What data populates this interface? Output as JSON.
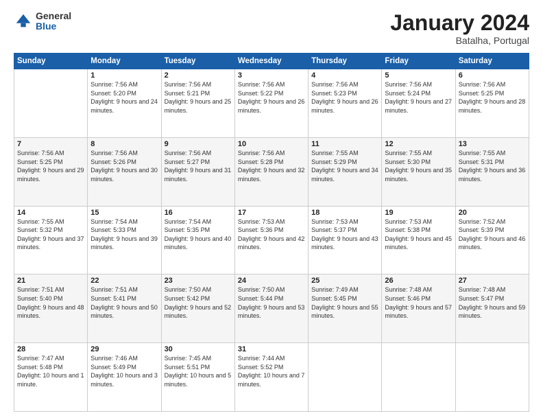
{
  "logo": {
    "general": "General",
    "blue": "Blue"
  },
  "header": {
    "title": "January 2024",
    "subtitle": "Batalha, Portugal"
  },
  "weekdays": [
    "Sunday",
    "Monday",
    "Tuesday",
    "Wednesday",
    "Thursday",
    "Friday",
    "Saturday"
  ],
  "weeks": [
    [
      {
        "day": "",
        "sunrise": "",
        "sunset": "",
        "daylight": ""
      },
      {
        "day": "1",
        "sunrise": "Sunrise: 7:56 AM",
        "sunset": "Sunset: 5:20 PM",
        "daylight": "Daylight: 9 hours and 24 minutes."
      },
      {
        "day": "2",
        "sunrise": "Sunrise: 7:56 AM",
        "sunset": "Sunset: 5:21 PM",
        "daylight": "Daylight: 9 hours and 25 minutes."
      },
      {
        "day": "3",
        "sunrise": "Sunrise: 7:56 AM",
        "sunset": "Sunset: 5:22 PM",
        "daylight": "Daylight: 9 hours and 26 minutes."
      },
      {
        "day": "4",
        "sunrise": "Sunrise: 7:56 AM",
        "sunset": "Sunset: 5:23 PM",
        "daylight": "Daylight: 9 hours and 26 minutes."
      },
      {
        "day": "5",
        "sunrise": "Sunrise: 7:56 AM",
        "sunset": "Sunset: 5:24 PM",
        "daylight": "Daylight: 9 hours and 27 minutes."
      },
      {
        "day": "6",
        "sunrise": "Sunrise: 7:56 AM",
        "sunset": "Sunset: 5:25 PM",
        "daylight": "Daylight: 9 hours and 28 minutes."
      }
    ],
    [
      {
        "day": "7",
        "sunrise": "Sunrise: 7:56 AM",
        "sunset": "Sunset: 5:25 PM",
        "daylight": "Daylight: 9 hours and 29 minutes."
      },
      {
        "day": "8",
        "sunrise": "Sunrise: 7:56 AM",
        "sunset": "Sunset: 5:26 PM",
        "daylight": "Daylight: 9 hours and 30 minutes."
      },
      {
        "day": "9",
        "sunrise": "Sunrise: 7:56 AM",
        "sunset": "Sunset: 5:27 PM",
        "daylight": "Daylight: 9 hours and 31 minutes."
      },
      {
        "day": "10",
        "sunrise": "Sunrise: 7:56 AM",
        "sunset": "Sunset: 5:28 PM",
        "daylight": "Daylight: 9 hours and 32 minutes."
      },
      {
        "day": "11",
        "sunrise": "Sunrise: 7:55 AM",
        "sunset": "Sunset: 5:29 PM",
        "daylight": "Daylight: 9 hours and 34 minutes."
      },
      {
        "day": "12",
        "sunrise": "Sunrise: 7:55 AM",
        "sunset": "Sunset: 5:30 PM",
        "daylight": "Daylight: 9 hours and 35 minutes."
      },
      {
        "day": "13",
        "sunrise": "Sunrise: 7:55 AM",
        "sunset": "Sunset: 5:31 PM",
        "daylight": "Daylight: 9 hours and 36 minutes."
      }
    ],
    [
      {
        "day": "14",
        "sunrise": "Sunrise: 7:55 AM",
        "sunset": "Sunset: 5:32 PM",
        "daylight": "Daylight: 9 hours and 37 minutes."
      },
      {
        "day": "15",
        "sunrise": "Sunrise: 7:54 AM",
        "sunset": "Sunset: 5:33 PM",
        "daylight": "Daylight: 9 hours and 39 minutes."
      },
      {
        "day": "16",
        "sunrise": "Sunrise: 7:54 AM",
        "sunset": "Sunset: 5:35 PM",
        "daylight": "Daylight: 9 hours and 40 minutes."
      },
      {
        "day": "17",
        "sunrise": "Sunrise: 7:53 AM",
        "sunset": "Sunset: 5:36 PM",
        "daylight": "Daylight: 9 hours and 42 minutes."
      },
      {
        "day": "18",
        "sunrise": "Sunrise: 7:53 AM",
        "sunset": "Sunset: 5:37 PM",
        "daylight": "Daylight: 9 hours and 43 minutes."
      },
      {
        "day": "19",
        "sunrise": "Sunrise: 7:53 AM",
        "sunset": "Sunset: 5:38 PM",
        "daylight": "Daylight: 9 hours and 45 minutes."
      },
      {
        "day": "20",
        "sunrise": "Sunrise: 7:52 AM",
        "sunset": "Sunset: 5:39 PM",
        "daylight": "Daylight: 9 hours and 46 minutes."
      }
    ],
    [
      {
        "day": "21",
        "sunrise": "Sunrise: 7:51 AM",
        "sunset": "Sunset: 5:40 PM",
        "daylight": "Daylight: 9 hours and 48 minutes."
      },
      {
        "day": "22",
        "sunrise": "Sunrise: 7:51 AM",
        "sunset": "Sunset: 5:41 PM",
        "daylight": "Daylight: 9 hours and 50 minutes."
      },
      {
        "day": "23",
        "sunrise": "Sunrise: 7:50 AM",
        "sunset": "Sunset: 5:42 PM",
        "daylight": "Daylight: 9 hours and 52 minutes."
      },
      {
        "day": "24",
        "sunrise": "Sunrise: 7:50 AM",
        "sunset": "Sunset: 5:44 PM",
        "daylight": "Daylight: 9 hours and 53 minutes."
      },
      {
        "day": "25",
        "sunrise": "Sunrise: 7:49 AM",
        "sunset": "Sunset: 5:45 PM",
        "daylight": "Daylight: 9 hours and 55 minutes."
      },
      {
        "day": "26",
        "sunrise": "Sunrise: 7:48 AM",
        "sunset": "Sunset: 5:46 PM",
        "daylight": "Daylight: 9 hours and 57 minutes."
      },
      {
        "day": "27",
        "sunrise": "Sunrise: 7:48 AM",
        "sunset": "Sunset: 5:47 PM",
        "daylight": "Daylight: 9 hours and 59 minutes."
      }
    ],
    [
      {
        "day": "28",
        "sunrise": "Sunrise: 7:47 AM",
        "sunset": "Sunset: 5:48 PM",
        "daylight": "Daylight: 10 hours and 1 minute."
      },
      {
        "day": "29",
        "sunrise": "Sunrise: 7:46 AM",
        "sunset": "Sunset: 5:49 PM",
        "daylight": "Daylight: 10 hours and 3 minutes."
      },
      {
        "day": "30",
        "sunrise": "Sunrise: 7:45 AM",
        "sunset": "Sunset: 5:51 PM",
        "daylight": "Daylight: 10 hours and 5 minutes."
      },
      {
        "day": "31",
        "sunrise": "Sunrise: 7:44 AM",
        "sunset": "Sunset: 5:52 PM",
        "daylight": "Daylight: 10 hours and 7 minutes."
      },
      {
        "day": "",
        "sunrise": "",
        "sunset": "",
        "daylight": ""
      },
      {
        "day": "",
        "sunrise": "",
        "sunset": "",
        "daylight": ""
      },
      {
        "day": "",
        "sunrise": "",
        "sunset": "",
        "daylight": ""
      }
    ]
  ]
}
